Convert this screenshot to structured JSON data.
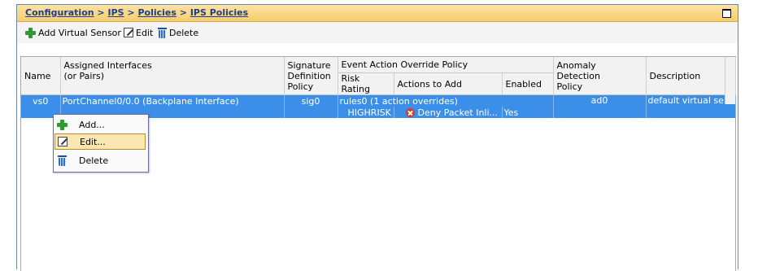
{
  "breadcrumb": {
    "part1": "Configuration",
    "part2": "IPS",
    "part3": "Policies",
    "part4": "IPS Policies",
    "sep": " > "
  },
  "toolbar": {
    "add_label": "Add Virtual Sensor",
    "edit_label": "Edit",
    "delete_label": "Delete"
  },
  "table": {
    "headers": {
      "name": "Name",
      "assigned_interfaces": "Assigned Interfaces\n(or Pairs)",
      "signature_policy": "Signature\nDefinition\nPolicy",
      "event_action_group": "Event Action Override Policy",
      "risk_rating": "Risk Rating",
      "actions_to_add": "Actions to Add",
      "enabled": "Enabled",
      "anomaly_detection": "Anomaly Detection\nPolicy",
      "description": "Description"
    },
    "rows": [
      {
        "name": "vs0",
        "interfaces": "PortChannel0/0.0 (Backplane Interface)",
        "signature_policy": "sig0",
        "event_action_policy": "rules0 (1 action overrides)",
        "anomaly_detection": "ad0",
        "description": "default virtual se...",
        "override": {
          "risk_rating": "HIGHRISK",
          "action": "Deny Packet Inli...",
          "enabled": "Yes"
        }
      }
    ]
  },
  "context_menu": {
    "items": [
      {
        "label": "Add...",
        "icon": "plus-icon"
      },
      {
        "label": "Edit...",
        "icon": "edit-icon"
      },
      {
        "label": "Delete",
        "icon": "trash-icon"
      }
    ]
  },
  "colors": {
    "selection": "#3c8fe8",
    "title_bar": "#f6cf6c",
    "link": "#1e3c8f",
    "menu_highlight": "#fbe7b1"
  }
}
